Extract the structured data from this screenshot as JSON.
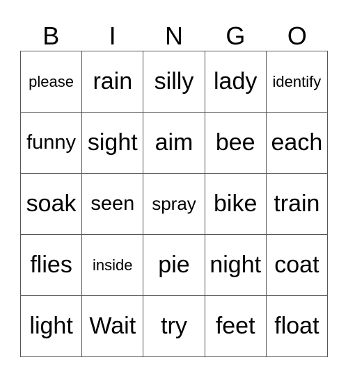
{
  "header": [
    "B",
    "I",
    "N",
    "G",
    "O"
  ],
  "cells": [
    [
      {
        "text": "please",
        "size": "sm"
      },
      {
        "text": "rain"
      },
      {
        "text": "silly"
      },
      {
        "text": "lady"
      },
      {
        "text": "identify",
        "size": "sm"
      }
    ],
    [
      {
        "text": "funny",
        "size": "lg"
      },
      {
        "text": "sight"
      },
      {
        "text": "aim"
      },
      {
        "text": "bee"
      },
      {
        "text": "each"
      }
    ],
    [
      {
        "text": "soak"
      },
      {
        "text": "seen",
        "size": "lg"
      },
      {
        "text": "spray",
        "size": "md"
      },
      {
        "text": "bike"
      },
      {
        "text": "train"
      }
    ],
    [
      {
        "text": "flies"
      },
      {
        "text": "inside",
        "size": "sm"
      },
      {
        "text": "pie"
      },
      {
        "text": "night"
      },
      {
        "text": "coat"
      }
    ],
    [
      {
        "text": "light"
      },
      {
        "text": "Wait"
      },
      {
        "text": "try"
      },
      {
        "text": "feet"
      },
      {
        "text": "float"
      }
    ]
  ]
}
